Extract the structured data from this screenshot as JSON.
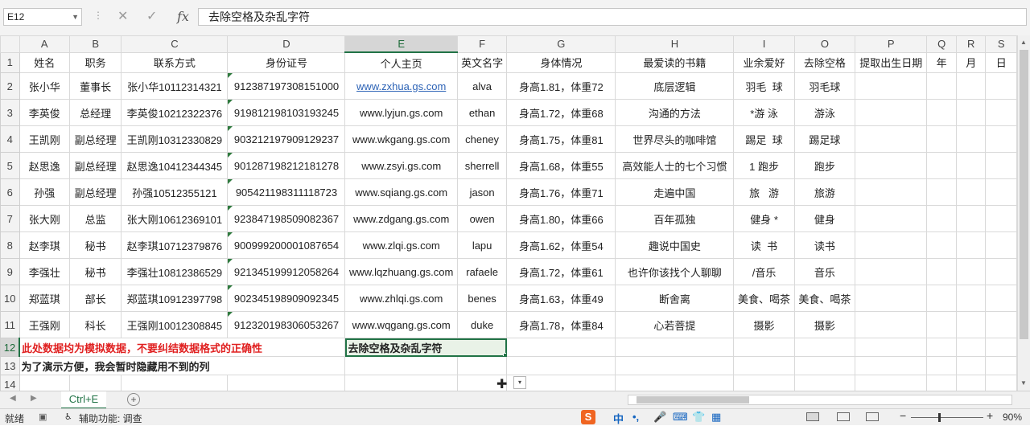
{
  "formula_bar": {
    "name_box": "E12",
    "cancel_glyph": "✕",
    "enter_glyph": "✓",
    "fx": "fx",
    "content": "去除空格及杂乱字符"
  },
  "columns": [
    "A",
    "B",
    "C",
    "D",
    "E",
    "F",
    "G",
    "H",
    "I",
    "O",
    "P",
    "Q",
    "R",
    "S"
  ],
  "header_row": [
    "姓名",
    "职务",
    "联系方式",
    "身份证号",
    "个人主页",
    "英文名字",
    "身体情况",
    "最爱读的书籍",
    "业余爱好",
    "去除空格",
    "提取出生日期",
    "年",
    "月",
    "日"
  ],
  "rows": [
    {
      "num": "2",
      "cells": [
        "张小华",
        "董事长",
        "张小华10112314321",
        "912387197308151000",
        "www.zxhua.gs.com",
        "alva",
        "身高1.81，体重72",
        "底层逻辑",
        "羽毛  球",
        "羽毛球",
        "",
        "",
        "",
        ""
      ]
    },
    {
      "num": "3",
      "cells": [
        "李英俊",
        "总经理",
        "李英俊10212322376",
        "919812198103193245",
        "www.lyjun.gs.com",
        "ethan",
        "身高1.72，体重68",
        "沟通的方法",
        "*游 泳",
        "游泳",
        "",
        "",
        "",
        ""
      ]
    },
    {
      "num": "4",
      "cells": [
        "王凯刚",
        "副总经理",
        "王凯刚10312330829",
        "903212197909129237",
        "www.wkgang.gs.com",
        "cheney",
        "身高1.75，体重81",
        "世界尽头的咖啡馆",
        "踢足  球",
        "踢足球",
        "",
        "",
        "",
        ""
      ]
    },
    {
      "num": "5",
      "cells": [
        "赵思逸",
        "副总经理",
        "赵思逸10412344345",
        "901287198212181278",
        "www.zsyi.gs.com",
        "sherrell",
        "身高1.68，体重55",
        "高效能人士的七个习惯",
        "1 跑步",
        "跑步",
        "",
        "",
        "",
        ""
      ]
    },
    {
      "num": "6",
      "cells": [
        "孙强",
        "副总经理",
        "孙强10512355121",
        "905421198311118723",
        "www.sqiang.gs.com",
        "jason",
        "身高1.76，体重71",
        "走遍中国",
        "旅   游",
        "旅游",
        "",
        "",
        "",
        ""
      ]
    },
    {
      "num": "7",
      "cells": [
        "张大刚",
        "总监",
        "张大刚10612369101",
        "923847198509082367",
        "www.zdgang.gs.com",
        "owen",
        "身高1.80，体重66",
        "百年孤独",
        "健身 *",
        "健身",
        "",
        "",
        "",
        ""
      ]
    },
    {
      "num": "8",
      "cells": [
        "赵李琪",
        "秘书",
        "赵李琪10712379876",
        "900999200001087654",
        "www.zlqi.gs.com",
        "lapu",
        "身高1.62，体重54",
        "趣说中国史",
        "读  书",
        "读书",
        "",
        "",
        "",
        ""
      ]
    },
    {
      "num": "9",
      "cells": [
        "李强壮",
        "秘书",
        "李强壮10812386529",
        "921345199912058264",
        "www.lqzhuang.gs.com",
        "rafaele",
        "身高1.72，体重61",
        "也许你该找个人聊聊",
        "/音乐",
        "音乐",
        "",
        "",
        "",
        ""
      ]
    },
    {
      "num": "10",
      "cells": [
        "郑蓝琪",
        "部长",
        "郑蓝琪10912397798",
        "902345198909092345",
        "www.zhlqi.gs.com",
        "benes",
        "身高1.63，体重49",
        "断舍离",
        "美食、喝茶",
        "美食、喝茶",
        "",
        "",
        "",
        ""
      ]
    },
    {
      "num": "11",
      "cells": [
        "王强刚",
        "科长",
        "王强刚10012308845",
        "912320198306053267",
        "www.wqgang.gs.com",
        "duke",
        "身高1.78，体重84",
        "心若菩提",
        "摄影",
        "摄影",
        "",
        "",
        "",
        ""
      ]
    }
  ],
  "row12": {
    "num": "12",
    "note": "此处数据均为模拟数据，不要纠结数据格式的正确性",
    "selected": "去除空格及杂乱字符"
  },
  "row13": {
    "num": "13",
    "note": "为了演示方便，我会暂时隐藏用不到的列"
  },
  "row14": {
    "num": "14"
  },
  "sheet_tab": "Ctrl+E",
  "status": {
    "ready": "就绪",
    "accessibility": "辅助功能: 调查",
    "ime_logo": "S",
    "ime_mode": "中",
    "zoom": "90%"
  },
  "colors": {
    "accent": "#217346",
    "link": "#2d63b6",
    "note_red": "#e02020"
  }
}
